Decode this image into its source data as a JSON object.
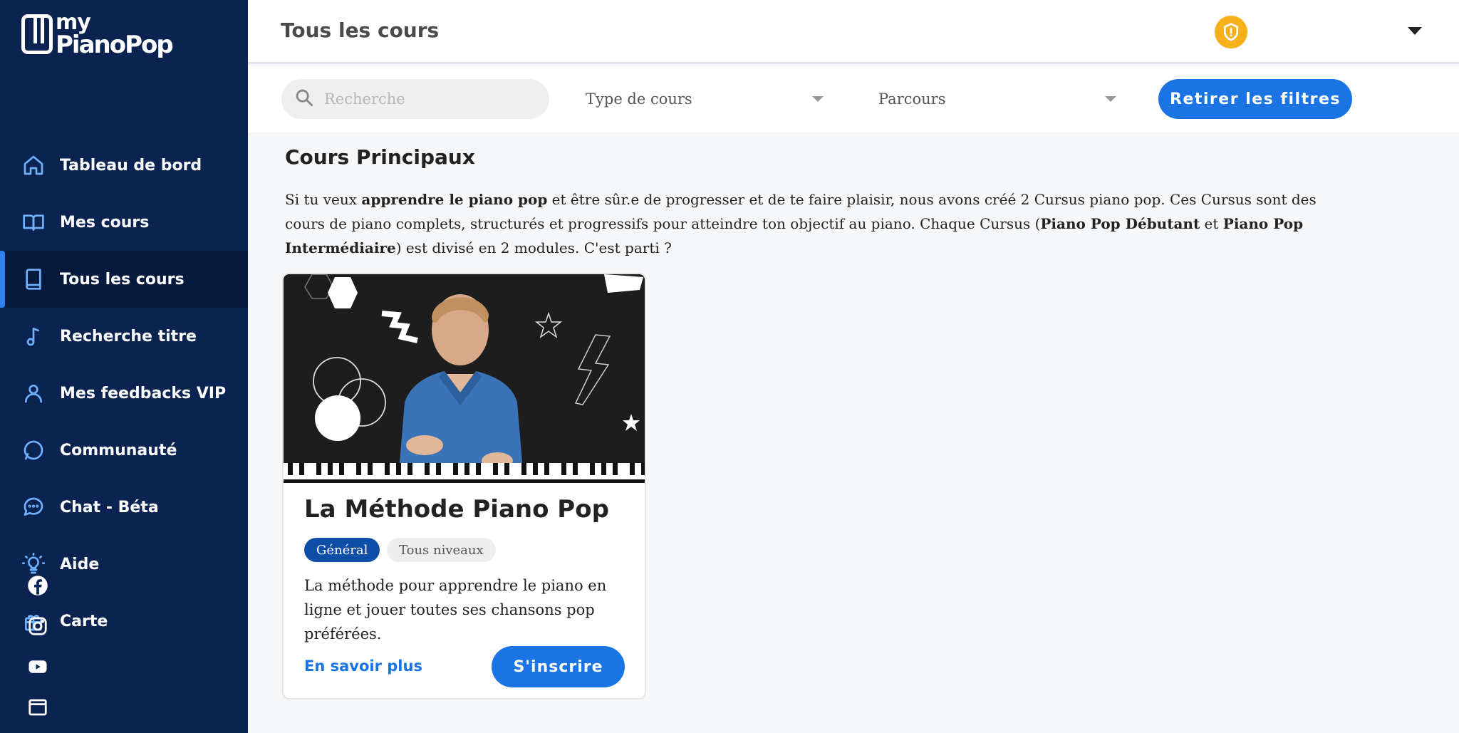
{
  "app": {
    "logo_line1": "my",
    "logo_line2": "PianoPop"
  },
  "sidebar": {
    "items": [
      {
        "label": "Tableau de bord",
        "icon": "home-icon"
      },
      {
        "label": "Mes cours",
        "icon": "book-open-icon"
      },
      {
        "label": "Tous les cours",
        "icon": "book-icon",
        "active": true
      },
      {
        "label": "Recherche titre",
        "icon": "music-note-icon"
      },
      {
        "label": "Mes feedbacks VIP",
        "icon": "user-icon"
      },
      {
        "label": "Communauté",
        "icon": "chat-bubble-icon"
      },
      {
        "label": "Chat - Béta",
        "icon": "chat-dots-icon"
      },
      {
        "label": "Aide",
        "icon": "lightbulb-icon"
      },
      {
        "label": "Carte",
        "icon": "gift-icon"
      }
    ],
    "social": [
      "facebook-icon",
      "instagram-icon",
      "youtube-icon",
      "browser-window-icon"
    ]
  },
  "header": {
    "title": "Tous les cours",
    "badge_icon": "shield-badge-icon"
  },
  "filters": {
    "search_placeholder": "Recherche",
    "type_label": "Type de cours",
    "parcours_label": "Parcours",
    "clear_button": "Retirer les filtres"
  },
  "main": {
    "section_title": "Cours Principaux",
    "intro": {
      "p1": "Si tu veux ",
      "b1": "apprendre le piano pop",
      "p2": " et être sûr.e de progresser et de te faire plaisir, nous avons créé 2 Cursus piano pop. Ces Cursus sont des cours de piano complets, structurés et progressifs pour atteindre ton objectif au piano. Chaque Cursus (",
      "b2": "Piano Pop Débutant",
      "p3": " et ",
      "b3": "Piano Pop Intermédiaire",
      "p4": ") est divisé en 2 modules. C'est parti ?"
    }
  },
  "course_card": {
    "title": "La Méthode Piano Pop",
    "tags": [
      "Général",
      "Tous niveaux"
    ],
    "description": "La méthode pour apprendre le piano en ligne et jouer toutes ses chansons pop préférées.",
    "more_link": "En savoir plus",
    "enroll_button": "S'inscrire"
  },
  "colors": {
    "sidebar_bg": "#0b2350",
    "sidebar_active_bg": "#061a3d",
    "accent": "#1a74e4",
    "icon_blue": "#6fb1ff",
    "tag_primary": "#0e4ea8",
    "badge_gold": "#f5b01a"
  }
}
